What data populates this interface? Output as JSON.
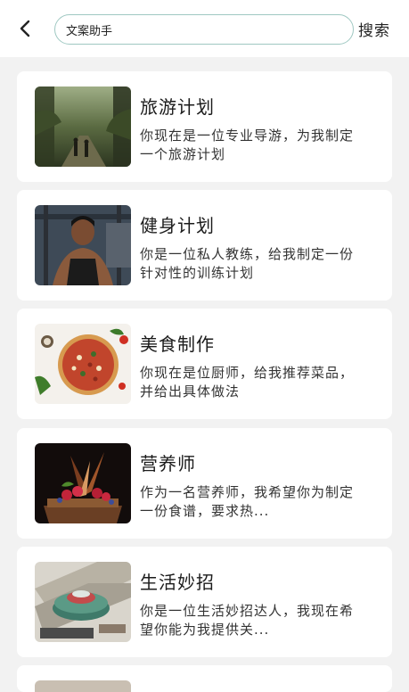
{
  "search": {
    "value": "文案助手",
    "button_label": "搜索"
  },
  "items": [
    {
      "title": "旅游计划",
      "desc": "你现在是一位专业导游，为我制定一个旅游计划",
      "image_icon": "jungle-travel-image"
    },
    {
      "title": "健身计划",
      "desc": "你是一位私人教练，给我制定一份针对性的训练计划",
      "image_icon": "fitness-trainer-image"
    },
    {
      "title": "美食制作",
      "desc": "你现在是位厨师，给我推荐菜品，并给出具体做法",
      "image_icon": "pizza-image"
    },
    {
      "title": "营养师",
      "desc": "作为一名营养师，我希望你为制定一份食谱，要求热...",
      "image_icon": "dessert-image"
    },
    {
      "title": "生活妙招",
      "desc": "你是一位生活妙招达人，我现在希望你能为我提供关...",
      "image_icon": "board-game-image"
    }
  ]
}
